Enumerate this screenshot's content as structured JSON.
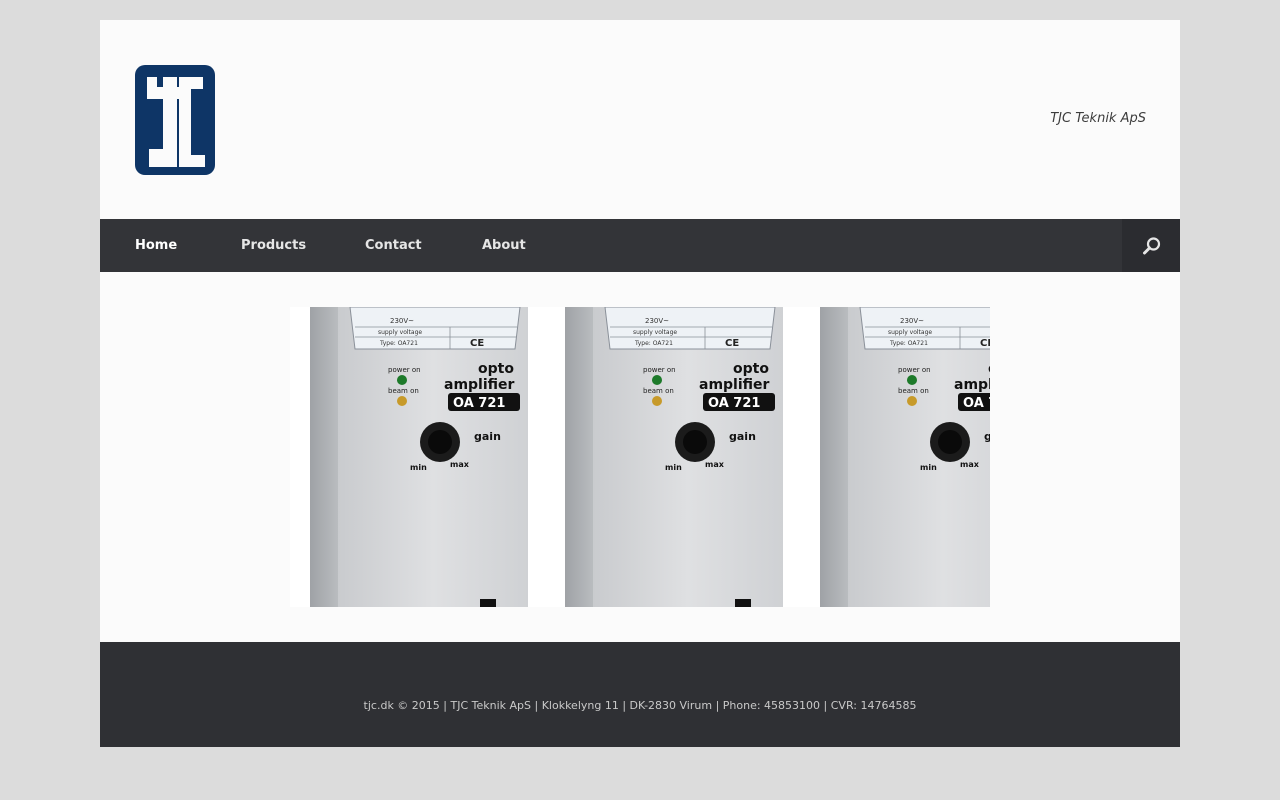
{
  "site": {
    "tagline": "TJC Teknik ApS"
  },
  "nav": {
    "items": [
      {
        "label": "Home",
        "active": true
      },
      {
        "label": "Products"
      },
      {
        "label": "Contact"
      },
      {
        "label": "About"
      }
    ],
    "search_icon": "search-icon"
  },
  "hero": {
    "module": {
      "indicator_power": "power on",
      "indicator_beam": "beam on",
      "brand_line1": "opto",
      "brand_line2": "amplifier",
      "model": "OA 721",
      "knob_label": "gain",
      "knob_min": "min",
      "knob_max": "max",
      "label_supply": "230V~",
      "label_supply_sub": "supply voltage",
      "label_type": "Type: OA721",
      "ce_mark": "CE"
    },
    "repeat_count": 3
  },
  "footer": {
    "text": "tjc.dk © 2015 | TJC Teknik ApS | Klokkelyng 11 | DK-2830 Virum | Phone: 45853100 | CVR: 14764585"
  },
  "colors": {
    "page_bg": "#dcdcdc",
    "nav_bg": "#333438",
    "footer_bg": "#2f3034",
    "logo_blue": "#0e3566"
  }
}
